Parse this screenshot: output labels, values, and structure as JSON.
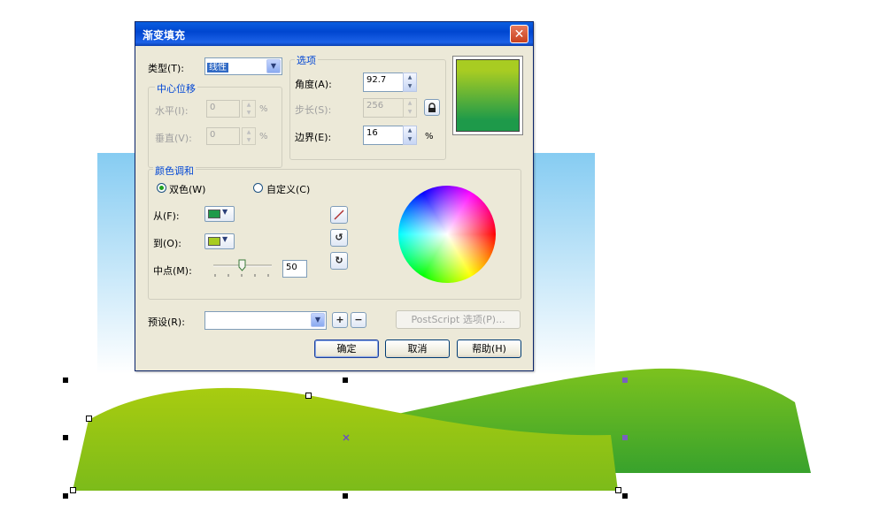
{
  "dialog": {
    "title": "渐变填充",
    "close_icon_glyph": "✕",
    "type_label": "类型(T):",
    "type_value": "线性",
    "center_offset": {
      "group_title": "中心位移",
      "horizontal_label": "水平(I):",
      "horizontal_value": "0",
      "vertical_label": "垂直(V):",
      "vertical_value": "0",
      "unit": "%"
    },
    "options": {
      "group_title": "选项",
      "angle_label": "角度(A):",
      "angle_value": "92.7",
      "steps_label": "步长(S):",
      "steps_value": "256",
      "edge_label": "边界(E):",
      "edge_value": "16",
      "edge_unit": "%"
    },
    "color_blend": {
      "group_title": "颜色调和",
      "two_color_label": "双色(W)",
      "custom_label": "自定义(C)",
      "selected_mode": "two_color",
      "from_label": "从(F):",
      "from_color": "#1e9a4a",
      "to_label": "到(O):",
      "to_color": "#a8cc22",
      "midpoint_label": "中点(M):",
      "midpoint_value": "50"
    },
    "presets_label": "预设(R):",
    "presets_value": "",
    "postscript_button": "PostScript 选项(P)...",
    "ok_button": "确定",
    "cancel_button": "取消",
    "help_button": "帮助(H)",
    "preview_colors": {
      "top": "#a8cc22",
      "bottom": "#1e9a4a"
    },
    "icons": {
      "lock_icon": "lock-icon",
      "direct_blend_icon": "diagonal-line-icon",
      "ccw_blend_icon": "counterclockwise-arrow-icon",
      "cw_blend_icon": "clockwise-arrow-icon",
      "add_preset_icon": "plus-icon",
      "remove_preset_icon": "minus-icon"
    }
  },
  "canvas": {
    "sky_colors": {
      "top": "#86ccf2",
      "bottom": "#ffffff"
    },
    "front_hill_colors": {
      "top": "#a8cc10",
      "bottom": "#7cbb1a"
    },
    "back_hill_colors": {
      "top": "#7cc21e",
      "bottom": "#38a22c"
    }
  }
}
